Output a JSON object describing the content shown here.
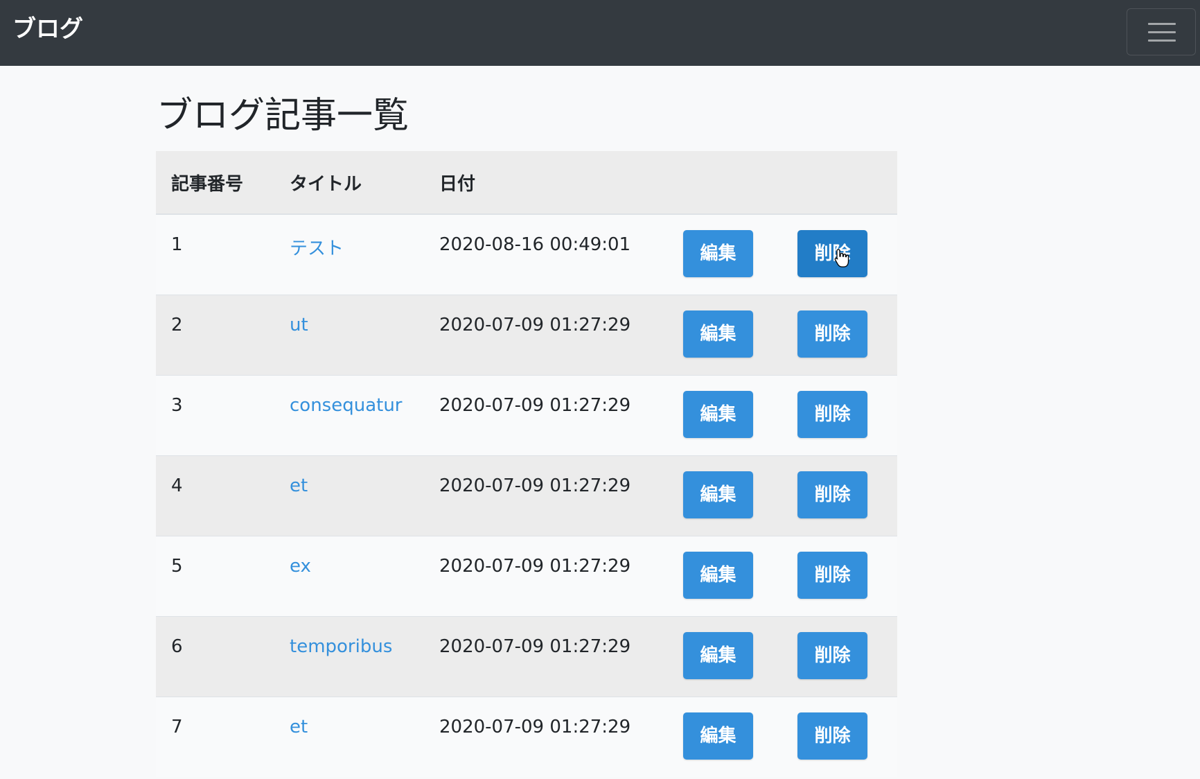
{
  "navbar": {
    "brand": "ブログ",
    "toggler_icon": "hamburger-menu-icon",
    "background": "#343a40"
  },
  "main": {
    "title": "ブログ記事一覧"
  },
  "table": {
    "headers": [
      "記事番号",
      "タイトル",
      "日付"
    ],
    "edit_label": "編集",
    "delete_label": "削除",
    "rows": [
      {
        "id": "1",
        "title": "テスト",
        "date": "2020-08-16 00:49:01"
      },
      {
        "id": "2",
        "title": "ut",
        "date": "2020-07-09 01:27:29"
      },
      {
        "id": "3",
        "title": "consequatur",
        "date": "2020-07-09 01:27:29"
      },
      {
        "id": "4",
        "title": "et",
        "date": "2020-07-09 01:27:29"
      },
      {
        "id": "5",
        "title": "ex",
        "date": "2020-07-09 01:27:29"
      },
      {
        "id": "6",
        "title": "temporibus",
        "date": "2020-07-09 01:27:29"
      },
      {
        "id": "7",
        "title": "et",
        "date": "2020-07-09 01:27:29"
      }
    ]
  },
  "colors": {
    "button": "#3490dc",
    "button_hover": "#227dc7",
    "link": "#3490dc"
  },
  "cursor_icon": "hand-pointer-icon"
}
